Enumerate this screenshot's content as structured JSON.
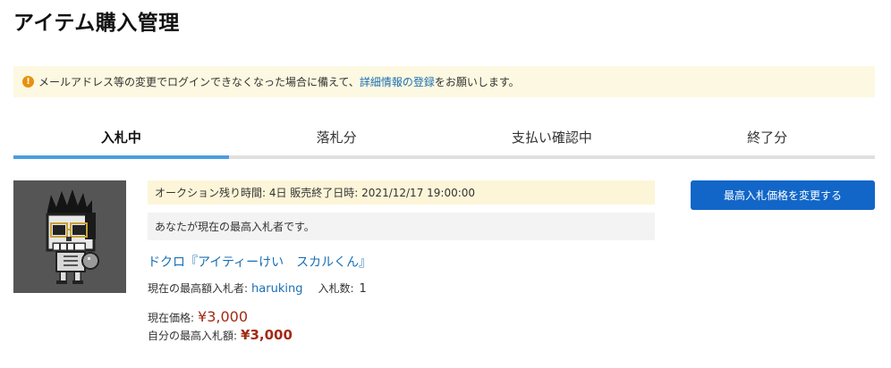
{
  "page": {
    "title": "アイテム購入管理"
  },
  "notice": {
    "icon": "info-icon",
    "text_before": "メールアドレス等の変更でログインできなくなった場合に備えて、",
    "link": "詳細情報の登録",
    "text_after": "をお願いします。"
  },
  "tabs": [
    {
      "label": "入札中",
      "active": true
    },
    {
      "label": "落札分",
      "active": false
    },
    {
      "label": "支払い確認中",
      "active": false
    },
    {
      "label": "終了分",
      "active": false
    }
  ],
  "auction": {
    "time_text": "オークション残り時間: 4日 販売終了日時: 2021/12/17 19:00:00",
    "status_text": "あなたが現在の最高入札者です。",
    "item_name": "ドクロ『アイティーけい　スカルくん』",
    "highest_bidder_label": "現在の最高額入札者:",
    "highest_bidder": "haruking",
    "bid_count_label": "入札数:",
    "bid_count": "1",
    "current_price_label": "現在価格:",
    "current_price": "¥3,000",
    "my_max_label": "自分の最高入札額:",
    "my_max": "¥3,000",
    "change_button": "最高入札価格を変更する"
  },
  "colors": {
    "accent": "#1166c8",
    "link": "#1a6fb4",
    "price": "#a42a14",
    "tab_active": "#4a9de3",
    "notice_bg": "#fdf8e1"
  }
}
